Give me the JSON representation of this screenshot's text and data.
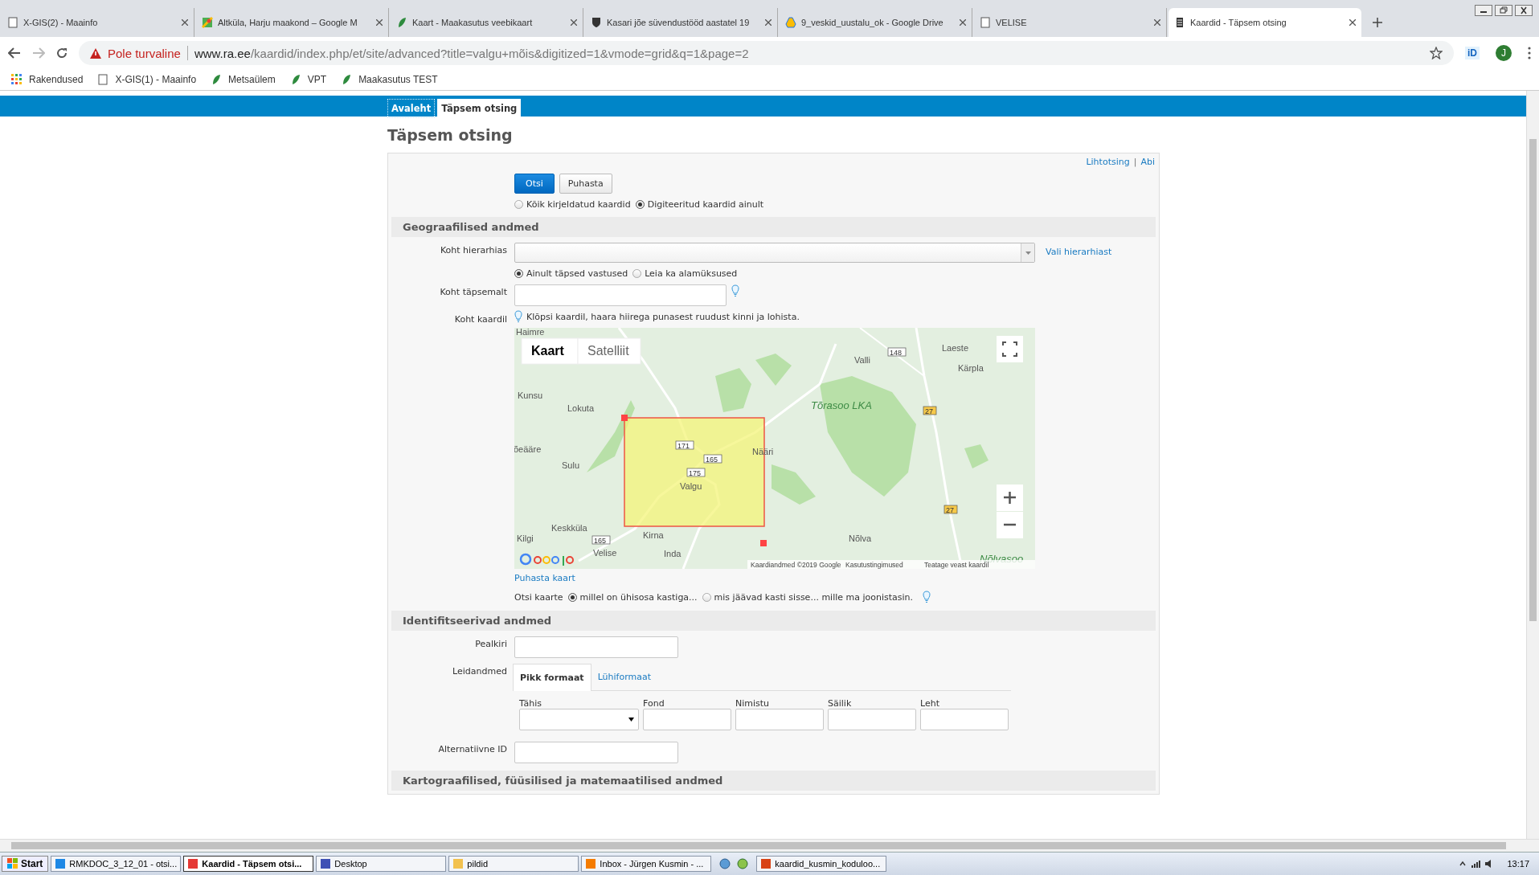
{
  "browser": {
    "tabs": [
      {
        "title": "X-GIS(2) - Maainfo",
        "selected": false
      },
      {
        "title": "Altküla, Harju maakond – Google M",
        "selected": false
      },
      {
        "title": "Kaart - Maakasutus veebikaart",
        "selected": false
      },
      {
        "title": "Kasari jõe süvendustööd aastatel 19",
        "selected": false
      },
      {
        "title": "9_veskid_uustalu_ok - Google Drive",
        "selected": false
      },
      {
        "title": "VELISE",
        "selected": false
      },
      {
        "title": "Kaardid - Täpsem otsing",
        "selected": true
      }
    ],
    "security": "Pole turvaline",
    "url_host": "www.ra.ee",
    "url_path": "/kaardid/index.php/et/site/advanced?title=valgu+mõis&digitized=1&vmode=grid&q=1&page=2",
    "extension": "iD",
    "profile": "J",
    "bookmarks": [
      "Rakendused",
      "X-GIS(1) - Maainfo",
      "Metsaülem",
      "VPT",
      "Maakasutus TEST"
    ]
  },
  "nav": [
    {
      "label": "Avaleht",
      "selected": false
    },
    {
      "label": "Täpsem otsing",
      "selected": true
    }
  ],
  "heading": "Täpsem otsing",
  "top_links": [
    "Lihtotsing",
    "|",
    "Abi"
  ],
  "buttons": [
    {
      "label": "Otsi",
      "kind": "primary"
    },
    {
      "label": "Puhasta",
      "kind": "secondary"
    }
  ],
  "scope": [
    {
      "label": "Kõik kirjeldatud kaardid",
      "selected": false
    },
    {
      "label": "Digiteeritud kaardid ainult",
      "selected": true
    }
  ],
  "geo": {
    "title": "Geograafilised andmed",
    "hierarchy_label": "Koht hierarhias",
    "hierarchy_link": "Vali hierarhiast",
    "match": [
      {
        "label": "Ainult täpsed vastused",
        "selected": true
      },
      {
        "label": "Leia ka alamüksused",
        "selected": false
      }
    ],
    "precise_label": "Koht täpsemalt",
    "map_label": "Koht kaardil",
    "map_hint": "Klõpsi kaardil, haara hiirega punasest ruudust kinni ja lohista.",
    "map": {
      "types": [
        {
          "label": "Kaart",
          "selected": true
        },
        {
          "label": "Satelliit",
          "selected": false
        }
      ],
      "places": [
        {
          "text": "Haimre",
          "kind": "place"
        },
        {
          "text": "Kunsu",
          "kind": "place"
        },
        {
          "text": "Lokuta",
          "kind": "place"
        },
        {
          "text": "õeääre",
          "kind": "place"
        },
        {
          "text": "Sulu",
          "kind": "place"
        },
        {
          "text": "Keskküla",
          "kind": "place"
        },
        {
          "text": "Kilgi",
          "kind": "place"
        },
        {
          "text": "Velise",
          "kind": "place"
        },
        {
          "text": "Inda",
          "kind": "place"
        },
        {
          "text": "Kirna",
          "kind": "place"
        },
        {
          "text": "Valgu",
          "kind": "place"
        },
        {
          "text": "Nääri",
          "kind": "place"
        },
        {
          "text": "Valli",
          "kind": "place"
        },
        {
          "text": "Laeste",
          "kind": "place"
        },
        {
          "text": "Kärpla",
          "kind": "place"
        },
        {
          "text": "Tõrasoo LKA",
          "kind": "park"
        },
        {
          "text": "Nõlva",
          "kind": "place"
        },
        {
          "text": "Nõlvasoo",
          "kind": "park"
        }
      ],
      "roads": [
        {
          "text": "171",
          "kind": "local"
        },
        {
          "text": "165",
          "kind": "local"
        },
        {
          "text": "175",
          "kind": "local"
        },
        {
          "text": "148",
          "kind": "local"
        },
        {
          "text": "27",
          "kind": "main"
        },
        {
          "text": "27",
          "kind": "main"
        },
        {
          "text": "165",
          "kind": "local"
        }
      ],
      "attribution": [
        "Kaardiandmed ©2019 Google",
        "Kasutustingimused",
        "Teatage veast kaardil"
      ]
    },
    "clear_map": "Puhasta kaart",
    "search_label": "Otsi kaarte",
    "search_modes": [
      {
        "label": "millel on ühisosa kastiga...",
        "selected": true
      },
      {
        "label": "mis jäävad kasti sisse... mille ma joonistasin.",
        "selected": false
      }
    ]
  },
  "ident": {
    "title": "Identifitseerivad andmed",
    "title_label": "Pealkiri",
    "ref_label": "Leidandmed",
    "ref_tabs": [
      {
        "label": "Pikk formaat",
        "selected": true
      },
      {
        "label": "Lühiformaat",
        "selected": false
      }
    ],
    "ref_fields": [
      {
        "label": "Tähis",
        "kind": "select"
      },
      {
        "label": "Fond",
        "kind": "text"
      },
      {
        "label": "Nimistu",
        "kind": "text"
      },
      {
        "label": "Säilik",
        "kind": "text"
      },
      {
        "label": "Leht",
        "kind": "text"
      }
    ],
    "alt_label": "Alternatiivne ID"
  },
  "carto": {
    "title": "Kartograafilised, füüsilised ja matemaatilised andmed"
  },
  "taskbar": {
    "start": "Start",
    "items": [
      {
        "label": "RMKDOC_3_12_01 - otsi...",
        "selected": false
      },
      {
        "label": "Kaardid - Täpsem otsi...",
        "selected": true
      },
      {
        "label": "Desktop",
        "selected": false
      },
      {
        "label": "pildid",
        "selected": false
      },
      {
        "label": "Inbox - Jürgen Kusmin - ...",
        "selected": false
      },
      {
        "label": "kaardid_kusmin_koduloo...",
        "selected": false
      }
    ],
    "time": "13:17"
  }
}
